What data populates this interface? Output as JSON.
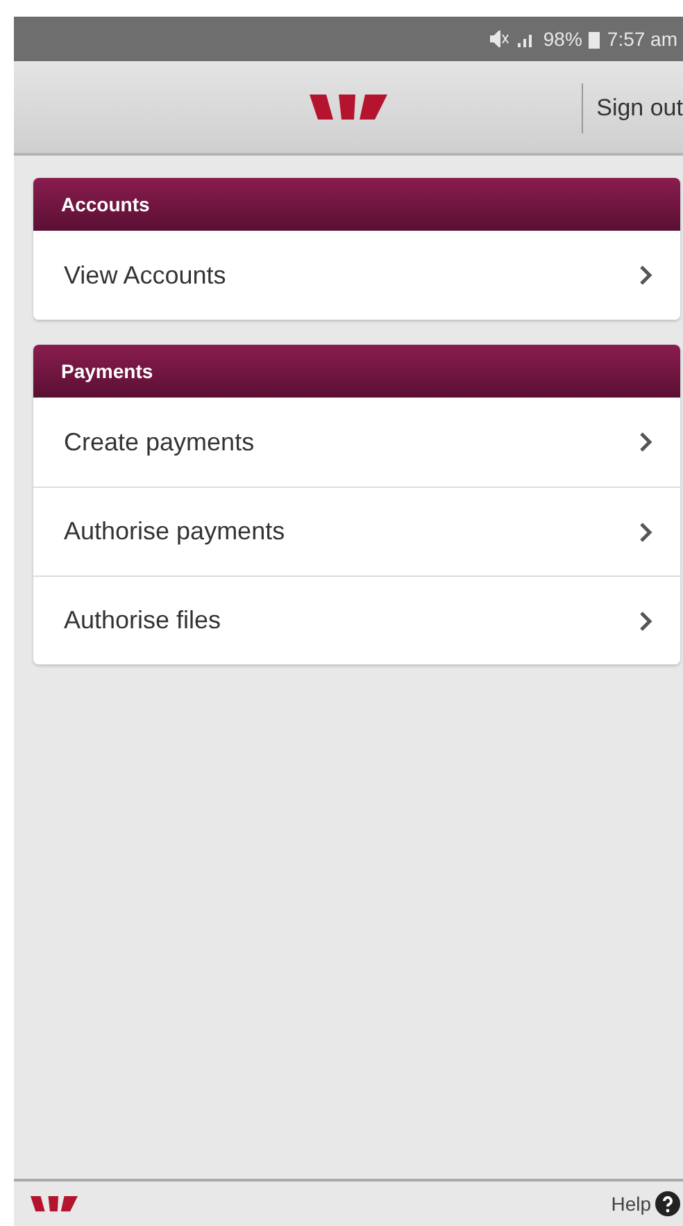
{
  "status_bar": {
    "battery": "98%",
    "time": "7:57 am"
  },
  "header": {
    "sign_out": "Sign out"
  },
  "sections": [
    {
      "title": "Accounts",
      "items": [
        {
          "label": "View Accounts"
        }
      ]
    },
    {
      "title": "Payments",
      "items": [
        {
          "label": "Create payments"
        },
        {
          "label": "Authorise payments"
        },
        {
          "label": "Authorise files"
        }
      ]
    }
  ],
  "footer": {
    "help": "Help"
  }
}
